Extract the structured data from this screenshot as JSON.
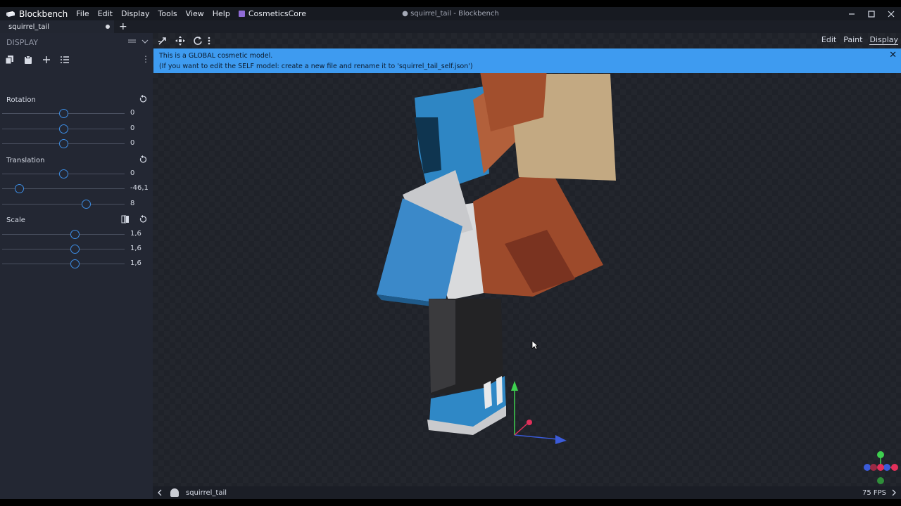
{
  "app": {
    "name": "Blockbench",
    "window_title": "● squirrel_tail - Blockbench",
    "menu": [
      "File",
      "Edit",
      "Display",
      "Tools",
      "View",
      "Help"
    ],
    "plugin_menu": "CosmeticsCore"
  },
  "tabs": [
    {
      "label": "squirrel_tail",
      "unsaved": true
    }
  ],
  "sidebar": {
    "panel_title": "DISPLAY",
    "sections": {
      "rotation": {
        "label": "Rotation",
        "values": [
          "0",
          "0",
          "0"
        ]
      },
      "translation": {
        "label": "Translation",
        "values": [
          "0",
          "-46,1",
          "8"
        ]
      },
      "scale": {
        "label": "Scale",
        "values": [
          "1,6",
          "1,6",
          "1,6"
        ]
      }
    }
  },
  "viewport": {
    "modes": [
      "Edit",
      "Paint",
      "Display"
    ],
    "active_mode": "Display",
    "banner": {
      "line1": "This is a GLOBAL cosmetic model.",
      "line2": "(If you want to edit the SELF model: create a new file and rename it to 'squirrel_tail_self.json')"
    }
  },
  "status": {
    "model_name": "squirrel_tail",
    "fps": "75 FPS"
  },
  "colors": {
    "accent": "#3e9bf0",
    "sidebar_bg": "#232733",
    "viewport_bg": "#1f2229",
    "axis_x": "#e2305a",
    "axis_y": "#3ecf4f",
    "axis_z": "#3b5bd9"
  }
}
